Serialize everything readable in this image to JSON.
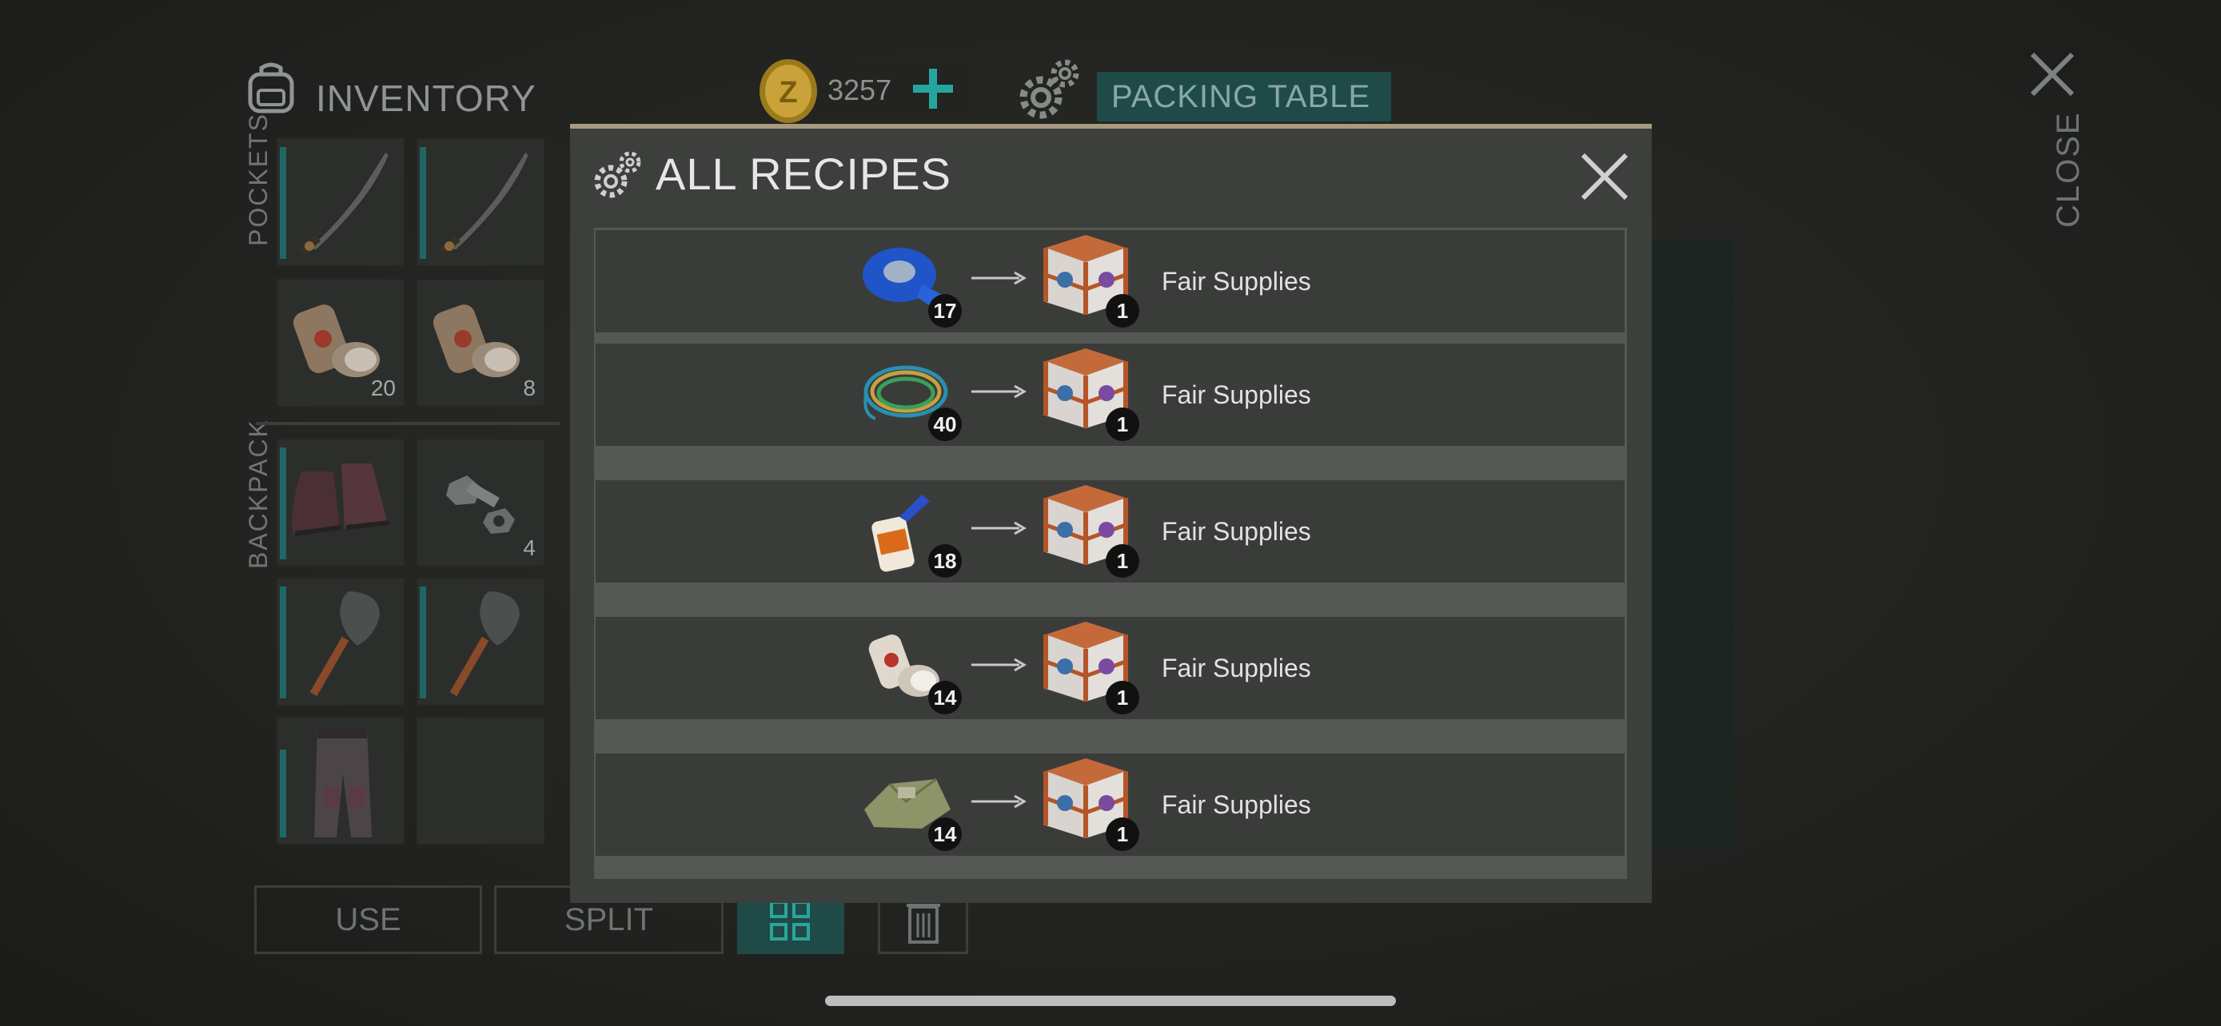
{
  "header": {
    "inventory_title": "INVENTORY",
    "coins": "3257",
    "packing_table": "PACKING TABLE",
    "close_label": "CLOSE"
  },
  "inventory": {
    "pockets_label": "POCKETS",
    "backpack_label": "BACKPACK",
    "slots": [
      {
        "item": "katana",
        "count": ""
      },
      {
        "item": "katana",
        "count": ""
      },
      {
        "item": "bandage",
        "count": "20"
      },
      {
        "item": "bandage",
        "count": "8"
      },
      {
        "item": "boots",
        "count": ""
      },
      {
        "item": "nuts-bolts",
        "count": "4"
      },
      {
        "item": "shovel",
        "count": ""
      },
      {
        "item": "shovel",
        "count": ""
      },
      {
        "item": "pants",
        "count": ""
      },
      {
        "item": "empty",
        "count": ""
      }
    ]
  },
  "actions": {
    "use": "USE",
    "split": "SPLIT"
  },
  "modal": {
    "title": "ALL RECIPES",
    "recipes": [
      {
        "ingredient": "duct-tape",
        "ingredient_count": "17",
        "result_count": "1",
        "result_name": "Fair Supplies"
      },
      {
        "ingredient": "wires",
        "ingredient_count": "40",
        "result_count": "1",
        "result_name": "Fair Supplies"
      },
      {
        "ingredient": "glue",
        "ingredient_count": "18",
        "result_count": "1",
        "result_name": "Fair Supplies"
      },
      {
        "ingredient": "bandage",
        "ingredient_count": "14",
        "result_count": "1",
        "result_name": "Fair Supplies"
      },
      {
        "ingredient": "cloth",
        "ingredient_count": "14",
        "result_count": "1",
        "result_name": "Fair Supplies"
      }
    ]
  },
  "colors": {
    "accent": "#24a59e",
    "modal_border": "#a79a7e",
    "packing_bg": "#1e4a48"
  }
}
